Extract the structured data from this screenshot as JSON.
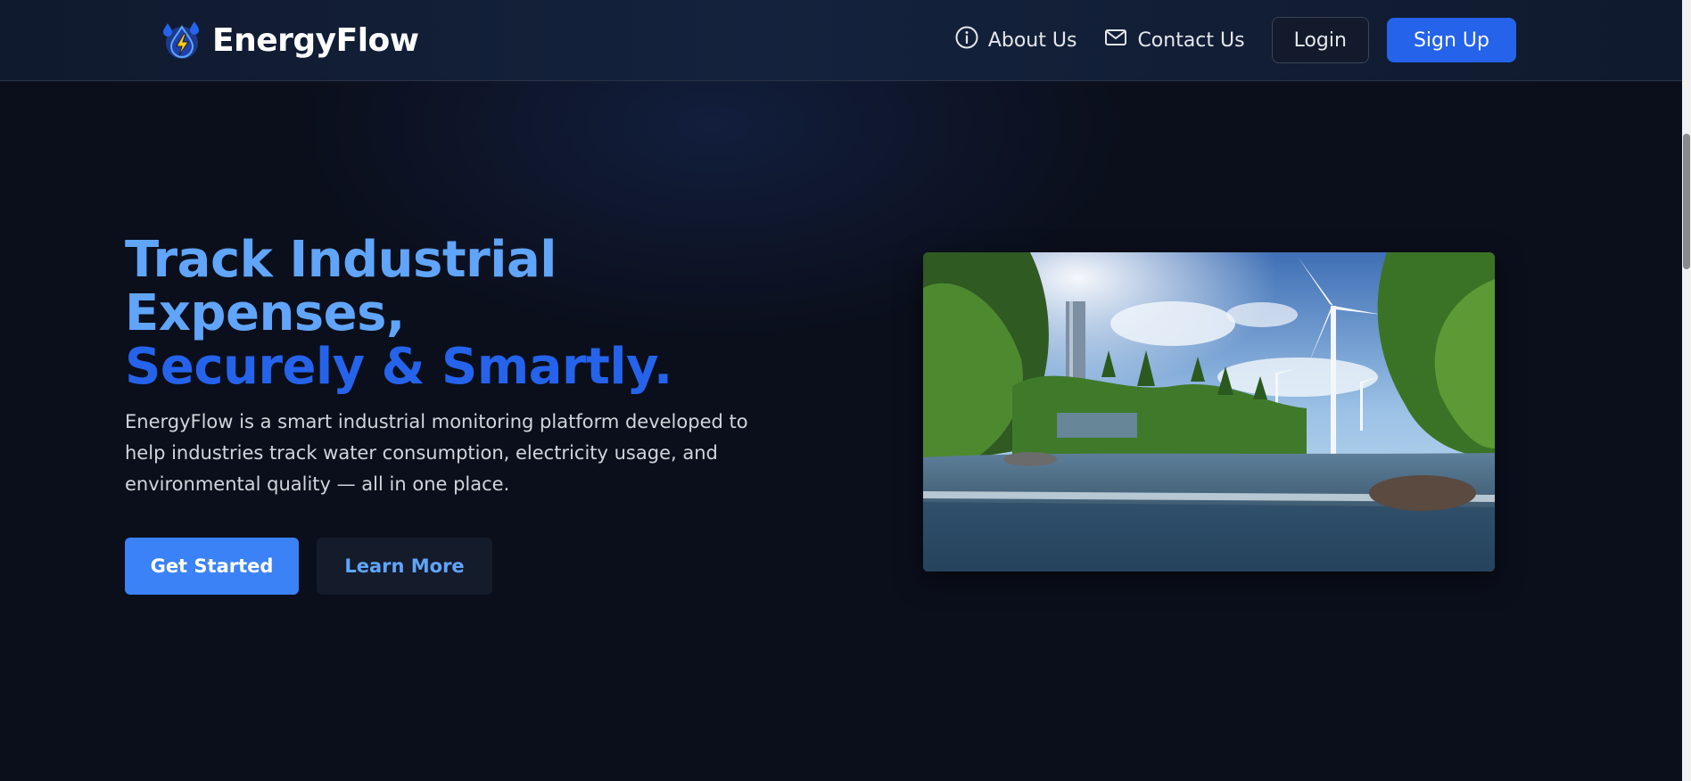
{
  "brand": {
    "name": "EnergyFlow",
    "logo_icon": "droplet-bolt-icon"
  },
  "nav": {
    "about_label": "About Us",
    "about_icon": "info-icon",
    "contact_label": "Contact Us",
    "contact_icon": "mail-icon",
    "login_label": "Login",
    "signup_label": "Sign Up"
  },
  "hero": {
    "title_line1": "Track Industrial",
    "title_line2": "Expenses,",
    "title_line3": "Securely & Smartly.",
    "description": "EnergyFlow is a smart industrial monitoring platform developed to help industries track water consumption, electricity usage, and environmental quality — all in one place.",
    "primary_button": "Get Started",
    "secondary_button": "Learn More",
    "image_subject": "landscape-wind-turbines-river-image"
  },
  "colors": {
    "background": "#0b0f1c",
    "accent": "#2563eb",
    "accent_light": "#60a5fa",
    "primary_button": "#3b82f6"
  }
}
